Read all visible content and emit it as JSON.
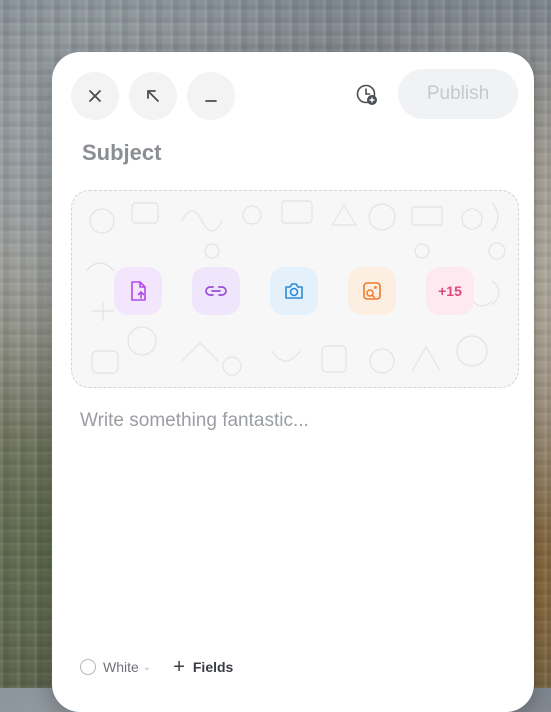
{
  "composer": {
    "publish_label": "Publish",
    "subject_placeholder": "Subject",
    "body_placeholder": "Write something fantastic...",
    "media_actions": [
      {
        "icon": "file-upload-icon",
        "color": "#b24ae8",
        "bg": "#f3e6fc"
      },
      {
        "icon": "link-icon",
        "color": "#9a4ad8",
        "bg": "#efe6fb"
      },
      {
        "icon": "camera-icon",
        "color": "#2c8bd6",
        "bg": "#e4f1fb"
      },
      {
        "icon": "image-search-icon",
        "color": "#ee7a2a",
        "bg": "#fdeee2"
      },
      {
        "icon": "more-icon",
        "label": "+15",
        "color": "#e0457b",
        "bg": "#fde9ef"
      }
    ],
    "footer": {
      "color_value": "White",
      "fields_label": "Fields"
    }
  }
}
